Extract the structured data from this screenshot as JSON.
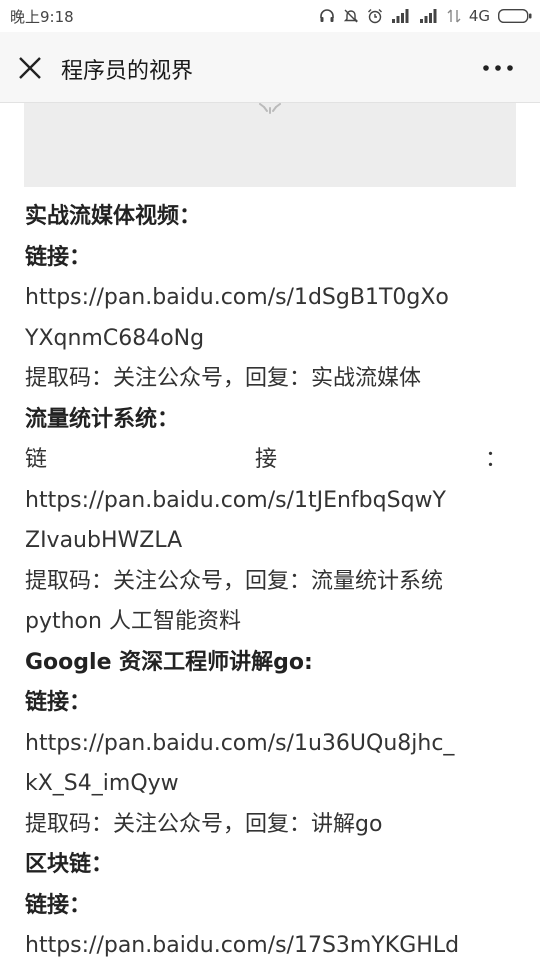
{
  "status_bar": {
    "time": "晚上9:18",
    "network": "4G",
    "icons": [
      "headphones-icon",
      "mute-bell-icon",
      "alarm-icon",
      "signal-icon",
      "signal-icon",
      "wifi-off-icon",
      "battery-icon"
    ]
  },
  "nav": {
    "title": "程序员的视界",
    "close_icon": "close-icon",
    "more_icon": "more-icon"
  },
  "article": {
    "lines": [
      "实战流媒体视频：",
      "链接：",
      "https://pan.baidu.com/s/1dSgB1T0gXo",
      "YXqnmC684oNg",
      "提取码：关注公众号，回复：实战流媒体",
      "流量统计系统：",
      "链接：",
      "https://pan.baidu.com/s/1tJEnfbqSqwY",
      "ZIvaubHWZLA",
      "提取码：关注公众号，回复：流量统计系统",
      "python 人工智能资料",
      "Google 资深工程师讲解go:",
      "链接：",
      "https://pan.baidu.com/s/1u36UQu8jhc_",
      "kX_S4_imQyw",
      "提取码：关注公众号，回复：讲解go",
      "区块链：",
      "链接：",
      "https://pan.baidu.com/s/17S3mYKGHLd"
    ],
    "spaced_link": [
      "链",
      "接",
      "："
    ]
  }
}
